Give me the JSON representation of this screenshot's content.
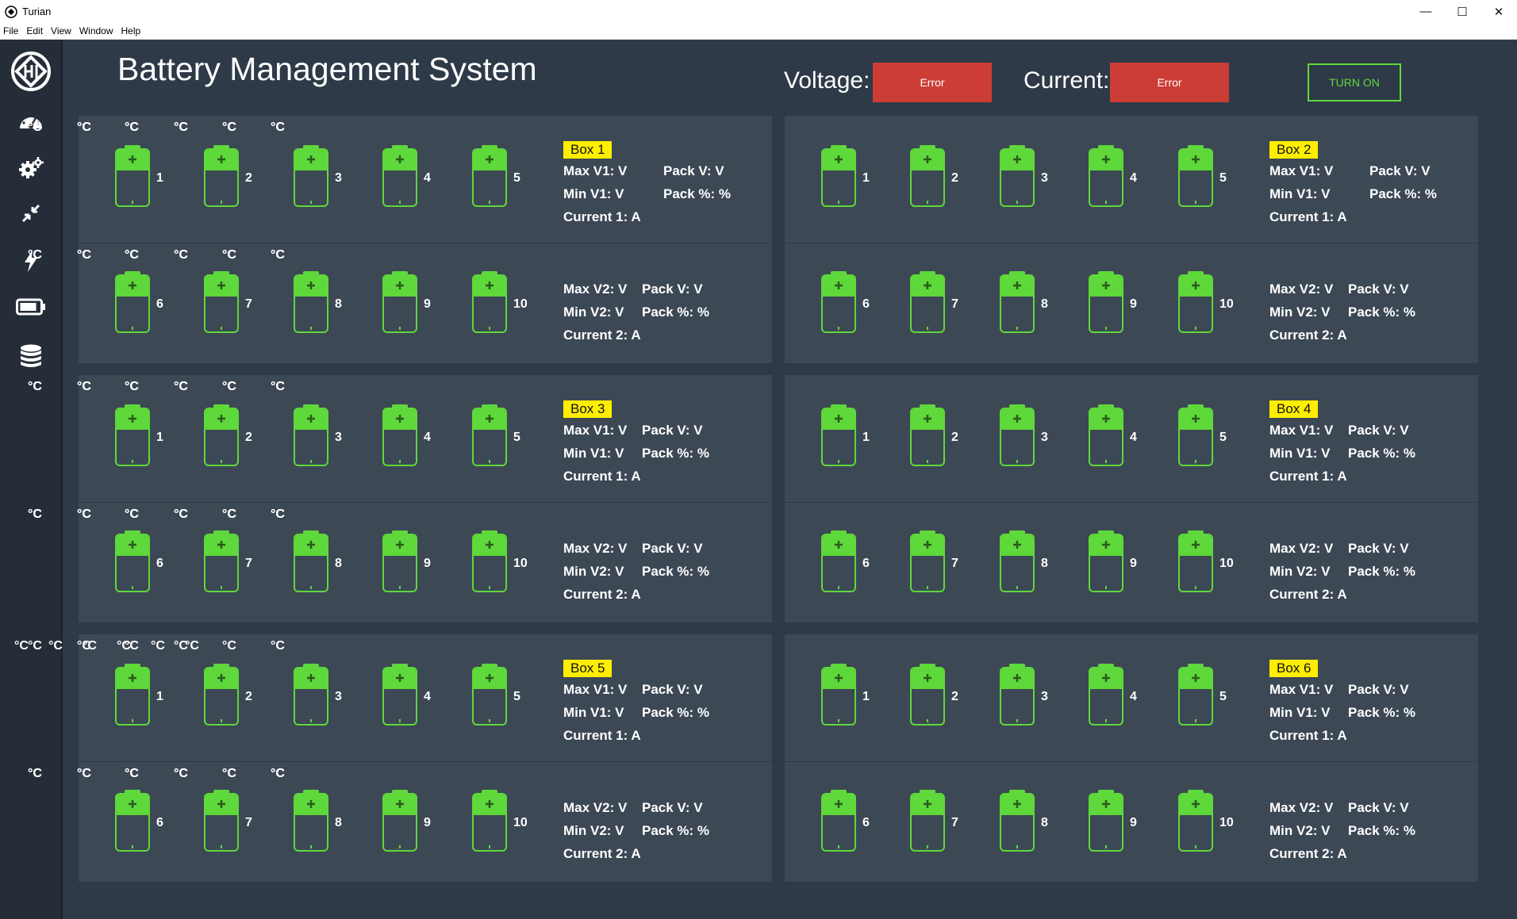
{
  "window": {
    "title": "Turian",
    "minimize": "—",
    "maximize": "☐",
    "close": "✕"
  },
  "menu": [
    "File",
    "Edit",
    "View",
    "Window",
    "Help"
  ],
  "sidebar": {
    "items": [
      {
        "name": "logo-icon"
      },
      {
        "name": "dashboard-gauge-icon"
      },
      {
        "name": "settings-gears-icon"
      },
      {
        "name": "compress-arrows-icon"
      },
      {
        "name": "power-bolt-icon"
      },
      {
        "name": "battery-icon"
      },
      {
        "name": "database-icon"
      }
    ]
  },
  "header": {
    "title": "Battery Management System",
    "voltage_label": "Voltage:",
    "voltage_value": "Error",
    "current_label": "Current:",
    "current_value": "Error",
    "turn_on_label": "TURN ON"
  },
  "colors": {
    "background": "#2e3a47",
    "panel": "#3d4855",
    "battery_green": "#5ed83a",
    "error_red": "#cc3d36",
    "badge_yellow": "#ffee00"
  },
  "temp_unit": "°C",
  "boxes": [
    {
      "badge": "Box 1",
      "top": {
        "cells": [
          "1",
          "2",
          "3",
          "4",
          "5"
        ],
        "max": "Max V1: V",
        "min": "Min V1: V",
        "current": "Current 1: A",
        "pack_v": "Pack V: V",
        "pack_pct": "Pack %: %"
      },
      "bottom": {
        "cells": [
          "6",
          "7",
          "8",
          "9",
          "10"
        ],
        "max": "Max V2: V",
        "min": "Min V2: V",
        "current": "Current 2: A",
        "pack_v": "Pack V: V",
        "pack_pct": "Pack %: %"
      }
    },
    {
      "badge": "Box 2",
      "top": {
        "cells": [
          "1",
          "2",
          "3",
          "4",
          "5"
        ],
        "max": "Max V1: V",
        "min": "Min V1: V",
        "current": "Current 1: A",
        "pack_v": "Pack V: V",
        "pack_pct": "Pack %: %"
      },
      "bottom": {
        "cells": [
          "6",
          "7",
          "8",
          "9",
          "10"
        ],
        "max": "Max V2: V",
        "min": "Min V2: V",
        "current": "Current 2: A",
        "pack_v": "Pack V: V",
        "pack_pct": "Pack %: %"
      }
    },
    {
      "badge": "Box 3",
      "top": {
        "cells": [
          "1",
          "2",
          "3",
          "4",
          "5"
        ],
        "max": "Max V1: V",
        "min": "Min V1: V",
        "current": "Current 1: A",
        "pack_v": "Pack V: V",
        "pack_pct": "Pack %: %"
      },
      "bottom": {
        "cells": [
          "6",
          "7",
          "8",
          "9",
          "10"
        ],
        "max": "Max V2: V",
        "min": "Min V2: V",
        "current": "Current 2: A",
        "pack_v": "Pack V: V",
        "pack_pct": "Pack %: %"
      }
    },
    {
      "badge": "Box 4",
      "top": {
        "cells": [
          "1",
          "2",
          "3",
          "4",
          "5"
        ],
        "max": "Max V1: V",
        "min": "Min V1: V",
        "current": "Current 1: A",
        "pack_v": "Pack V: V",
        "pack_pct": "Pack %: %"
      },
      "bottom": {
        "cells": [
          "6",
          "7",
          "8",
          "9",
          "10"
        ],
        "max": "Max V2: V",
        "min": "Min V2: V",
        "current": "Current 2: A",
        "pack_v": "Pack V: V",
        "pack_pct": "Pack %: %"
      }
    },
    {
      "badge": "Box 5",
      "top": {
        "cells": [
          "1",
          "2",
          "3",
          "4",
          "5"
        ],
        "max": "Max V1: V",
        "min": "Min V1: V",
        "current": "Current 1: A",
        "pack_v": "Pack V: V",
        "pack_pct": "Pack %: %"
      },
      "bottom": {
        "cells": [
          "6",
          "7",
          "8",
          "9",
          "10"
        ],
        "max": "Max V2: V",
        "min": "Min V2: V",
        "current": "Current 2: A",
        "pack_v": "Pack V: V",
        "pack_pct": "Pack %: %"
      }
    },
    {
      "badge": "Box 6",
      "top": {
        "cells": [
          "1",
          "2",
          "3",
          "4",
          "5"
        ],
        "max": "Max V1: V",
        "min": "Min V1: V",
        "current": "Current 1: A",
        "pack_v": "Pack V: V",
        "pack_pct": "Pack %: %"
      },
      "bottom": {
        "cells": [
          "6",
          "7",
          "8",
          "9",
          "10"
        ],
        "max": "Max V2: V",
        "min": "Min V2: V",
        "current": "Current 2: A",
        "pack_v": "Pack V: V",
        "pack_pct": "Pack %: %"
      }
    }
  ]
}
